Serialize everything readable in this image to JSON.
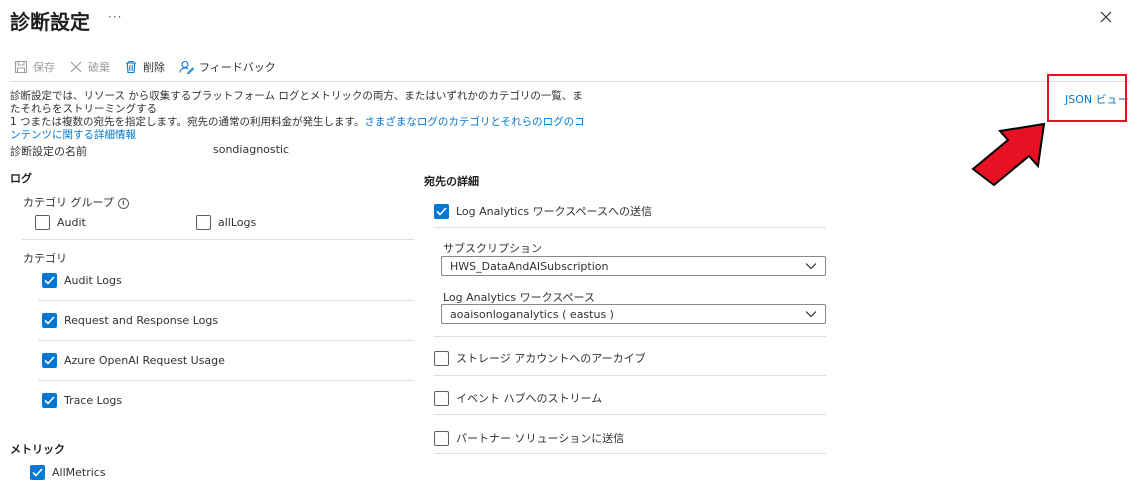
{
  "header": {
    "title": "診断設定",
    "more": "···"
  },
  "toolbar": {
    "save": "保存",
    "discard": "破棄",
    "delete": "削除",
    "feedback": "フィードバック"
  },
  "description": {
    "line1": "診断設定では、リソース から収集するプラットフォーム ログとメトリックの両方、またはいずれかのカテゴリの一覧、またそれらをストリーミングする",
    "line2": "1 つまたは複数の宛先を指定します。宛先の通常の利用料金が発生します。",
    "link": "さまざまなログのカテゴリとそれらのログのコンテンツに関する詳細情報"
  },
  "json_view": "JSON ビュー",
  "settings_name": {
    "label": "診断設定の名前",
    "value": "sondiagnostic"
  },
  "logs": {
    "section": "ログ",
    "category_groups_label": "カテゴリ グループ",
    "groups": [
      {
        "label": "Audit",
        "checked": false
      },
      {
        "label": "allLogs",
        "checked": false
      }
    ],
    "categories_label": "カテゴリ",
    "categories": [
      {
        "label": "Audit Logs",
        "checked": true
      },
      {
        "label": "Request and Response Logs",
        "checked": true
      },
      {
        "label": "Azure OpenAI Request Usage",
        "checked": true
      },
      {
        "label": "Trace Logs",
        "checked": true
      }
    ]
  },
  "metrics": {
    "section": "メトリック",
    "items": [
      {
        "label": "AllMetrics",
        "checked": true
      }
    ]
  },
  "destination": {
    "section": "宛先の詳細",
    "log_analytics": {
      "label": "Log Analytics ワークスペースへの送信",
      "checked": true
    },
    "subscription_label": "サブスクリプション",
    "subscription_value": "HWS_DataAndAISubscription",
    "workspace_label": "Log Analytics ワークスペース",
    "workspace_value": "aoaisonloganalytics ( eastus )",
    "storage": {
      "label": "ストレージ アカウントへのアーカイブ",
      "checked": false
    },
    "event_hub": {
      "label": "イベント ハブへのストリーム",
      "checked": false
    },
    "partner": {
      "label": "パートナー ソリューションに送信",
      "checked": false
    }
  },
  "colors": {
    "accent": "#0078d4",
    "highlight": "#e81123"
  }
}
